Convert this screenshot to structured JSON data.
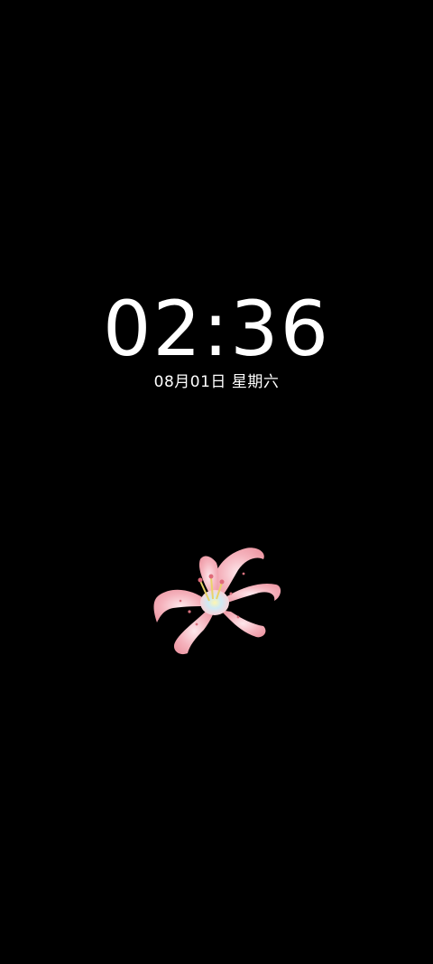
{
  "screen": {
    "background_color": "#000000"
  },
  "clock": {
    "time": "02:36",
    "date": "08月01日 星期六",
    "text_color": "#ffffff"
  },
  "decoration": {
    "icon": "lily-flower-illustration",
    "petal_color": "#f3aab4",
    "center_color": "#cfe8f2"
  }
}
